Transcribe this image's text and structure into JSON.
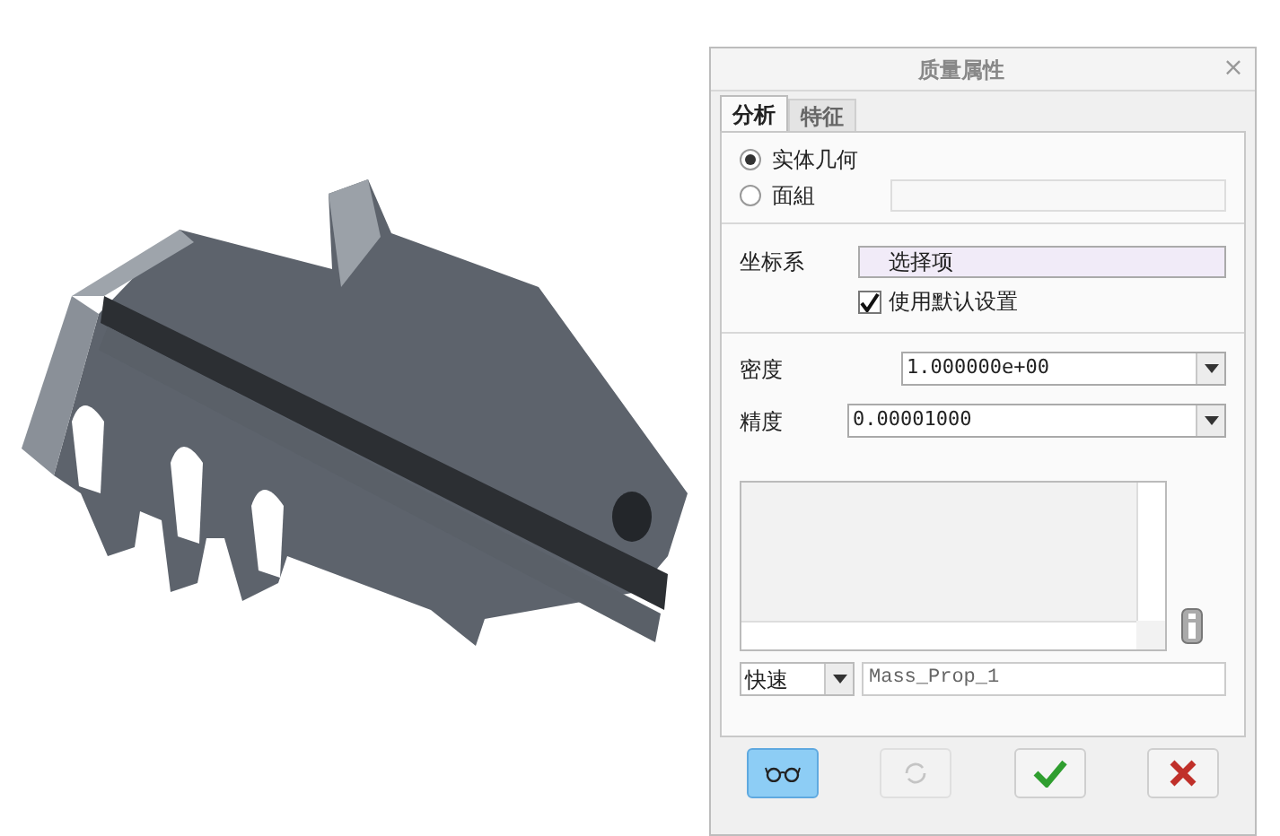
{
  "dialog": {
    "title": "质量属性",
    "close": "×"
  },
  "tabs": [
    {
      "label": "分析",
      "selected": true
    },
    {
      "label": "特征",
      "selected": false
    }
  ],
  "geometry_options": [
    {
      "label": "实体几何",
      "selected": true
    },
    {
      "label": "面組",
      "selected": false
    }
  ],
  "coordinate_system": {
    "label": "坐标系",
    "value": "选择项",
    "use_default": {
      "label": "使用默认设置",
      "checked": true
    }
  },
  "density": {
    "label": "密度",
    "value": "1.000000e+00"
  },
  "accuracy": {
    "label": "精度",
    "value": "0.00001000"
  },
  "mode": {
    "value": "快速"
  },
  "name": {
    "value": "Mass_Prop_1"
  },
  "buttons": [
    {
      "kind": "preview",
      "selected": true,
      "disabled": false
    },
    {
      "kind": "repeat",
      "selected": false,
      "disabled": true
    },
    {
      "kind": "ok",
      "selected": false,
      "disabled": false
    },
    {
      "kind": "cancel",
      "selected": false,
      "disabled": false
    }
  ]
}
